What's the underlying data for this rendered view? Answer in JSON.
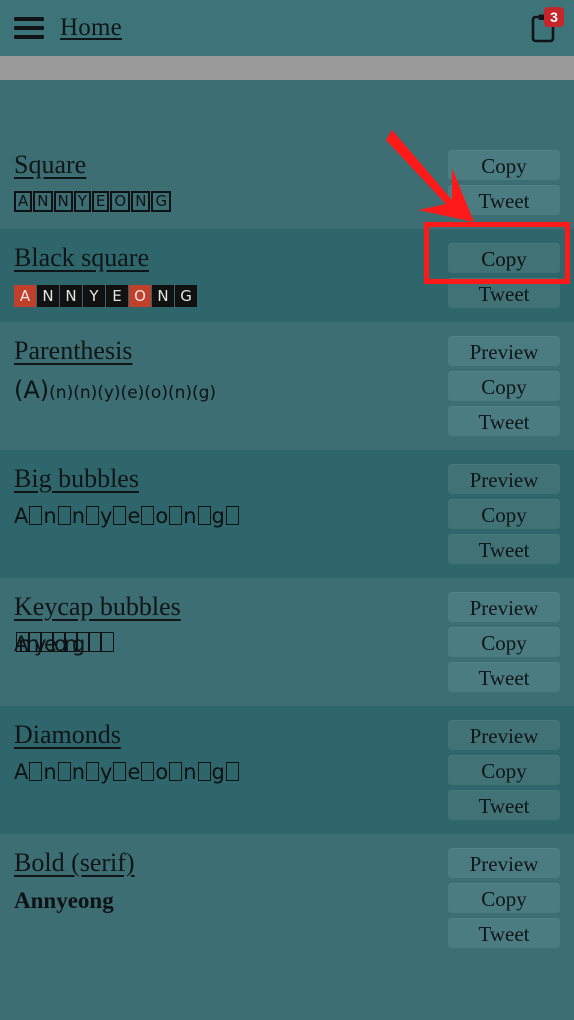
{
  "header": {
    "menu_icon": "hamburger-menu-icon",
    "title": "Home",
    "clipboard_icon": "clipboard-icon",
    "clipboard_badge": "3"
  },
  "colors": {
    "header_bg": "#3d7479",
    "row_light": "#3d6e73",
    "row_dark": "#2e666c",
    "button_bg": "#4b7c81",
    "button_highlight_bg": "#8fd4dd",
    "annotation_red": "#ff1a1a",
    "badge_red": "#c4262a",
    "partial_band_gray": "#9a9a9a",
    "partial_band_blue": "#3a57a8"
  },
  "buttons": {
    "preview": "Preview",
    "copy": "Copy",
    "tweet": "Tweet"
  },
  "rows": [
    {
      "title": "Square",
      "preview": "ANNYEONG",
      "preview_style": "boxed-letters",
      "actions": [
        "Copy",
        "Tweet"
      ],
      "shade": "light"
    },
    {
      "title": "Black square",
      "preview": "ANNYEONG",
      "preview_style": "black-filled-letters",
      "actions": [
        "Copy",
        "Tweet"
      ],
      "shade": "dark",
      "highlighted_action": "Copy"
    },
    {
      "title": "Parenthesis",
      "preview": "(A)(n)(n)(y)(e)(o)(n)(g)",
      "preview_style": "parenthesis",
      "actions": [
        "Preview",
        "Copy",
        "Tweet"
      ],
      "shade": "light"
    },
    {
      "title": "Big bubbles",
      "preview": "A□n□n□y□e□o□n□g□",
      "preview_style": "tofu",
      "actions": [
        "Preview",
        "Copy",
        "Tweet"
      ],
      "shade": "dark"
    },
    {
      "title": "Keycap bubbles",
      "preview": "Annyeong",
      "preview_style": "overlapping",
      "actions": [
        "Preview",
        "Copy",
        "Tweet"
      ],
      "shade": "light"
    },
    {
      "title": "Diamonds",
      "preview": "A□n□n□y□e□o□n□g□",
      "preview_style": "tofu",
      "actions": [
        "Preview",
        "Copy",
        "Tweet"
      ],
      "shade": "dark"
    },
    {
      "title": "Bold (serif)",
      "preview": "Annyeong",
      "preview_style": "bold-serif",
      "actions": [
        "Preview",
        "Copy",
        "Tweet"
      ],
      "shade": "light"
    }
  ],
  "square_letters": [
    "A",
    "N",
    "N",
    "Y",
    "E",
    "O",
    "N",
    "G"
  ],
  "black_square_letters": [
    {
      "ch": "A",
      "highlight": true
    },
    {
      "ch": "N",
      "highlight": false
    },
    {
      "ch": "N",
      "highlight": false
    },
    {
      "ch": "Y",
      "highlight": false
    },
    {
      "ch": "E",
      "highlight": false
    },
    {
      "ch": "O",
      "highlight": true
    },
    {
      "ch": "N",
      "highlight": false
    },
    {
      "ch": "G",
      "highlight": false
    }
  ],
  "paren_first": "(A)",
  "paren_rest": "(n)(n)(y)(e)(o)(n)(g)",
  "annotation": {
    "arrow_icon": "red-arrow-icon",
    "box_target": "copy-button-black-square"
  }
}
